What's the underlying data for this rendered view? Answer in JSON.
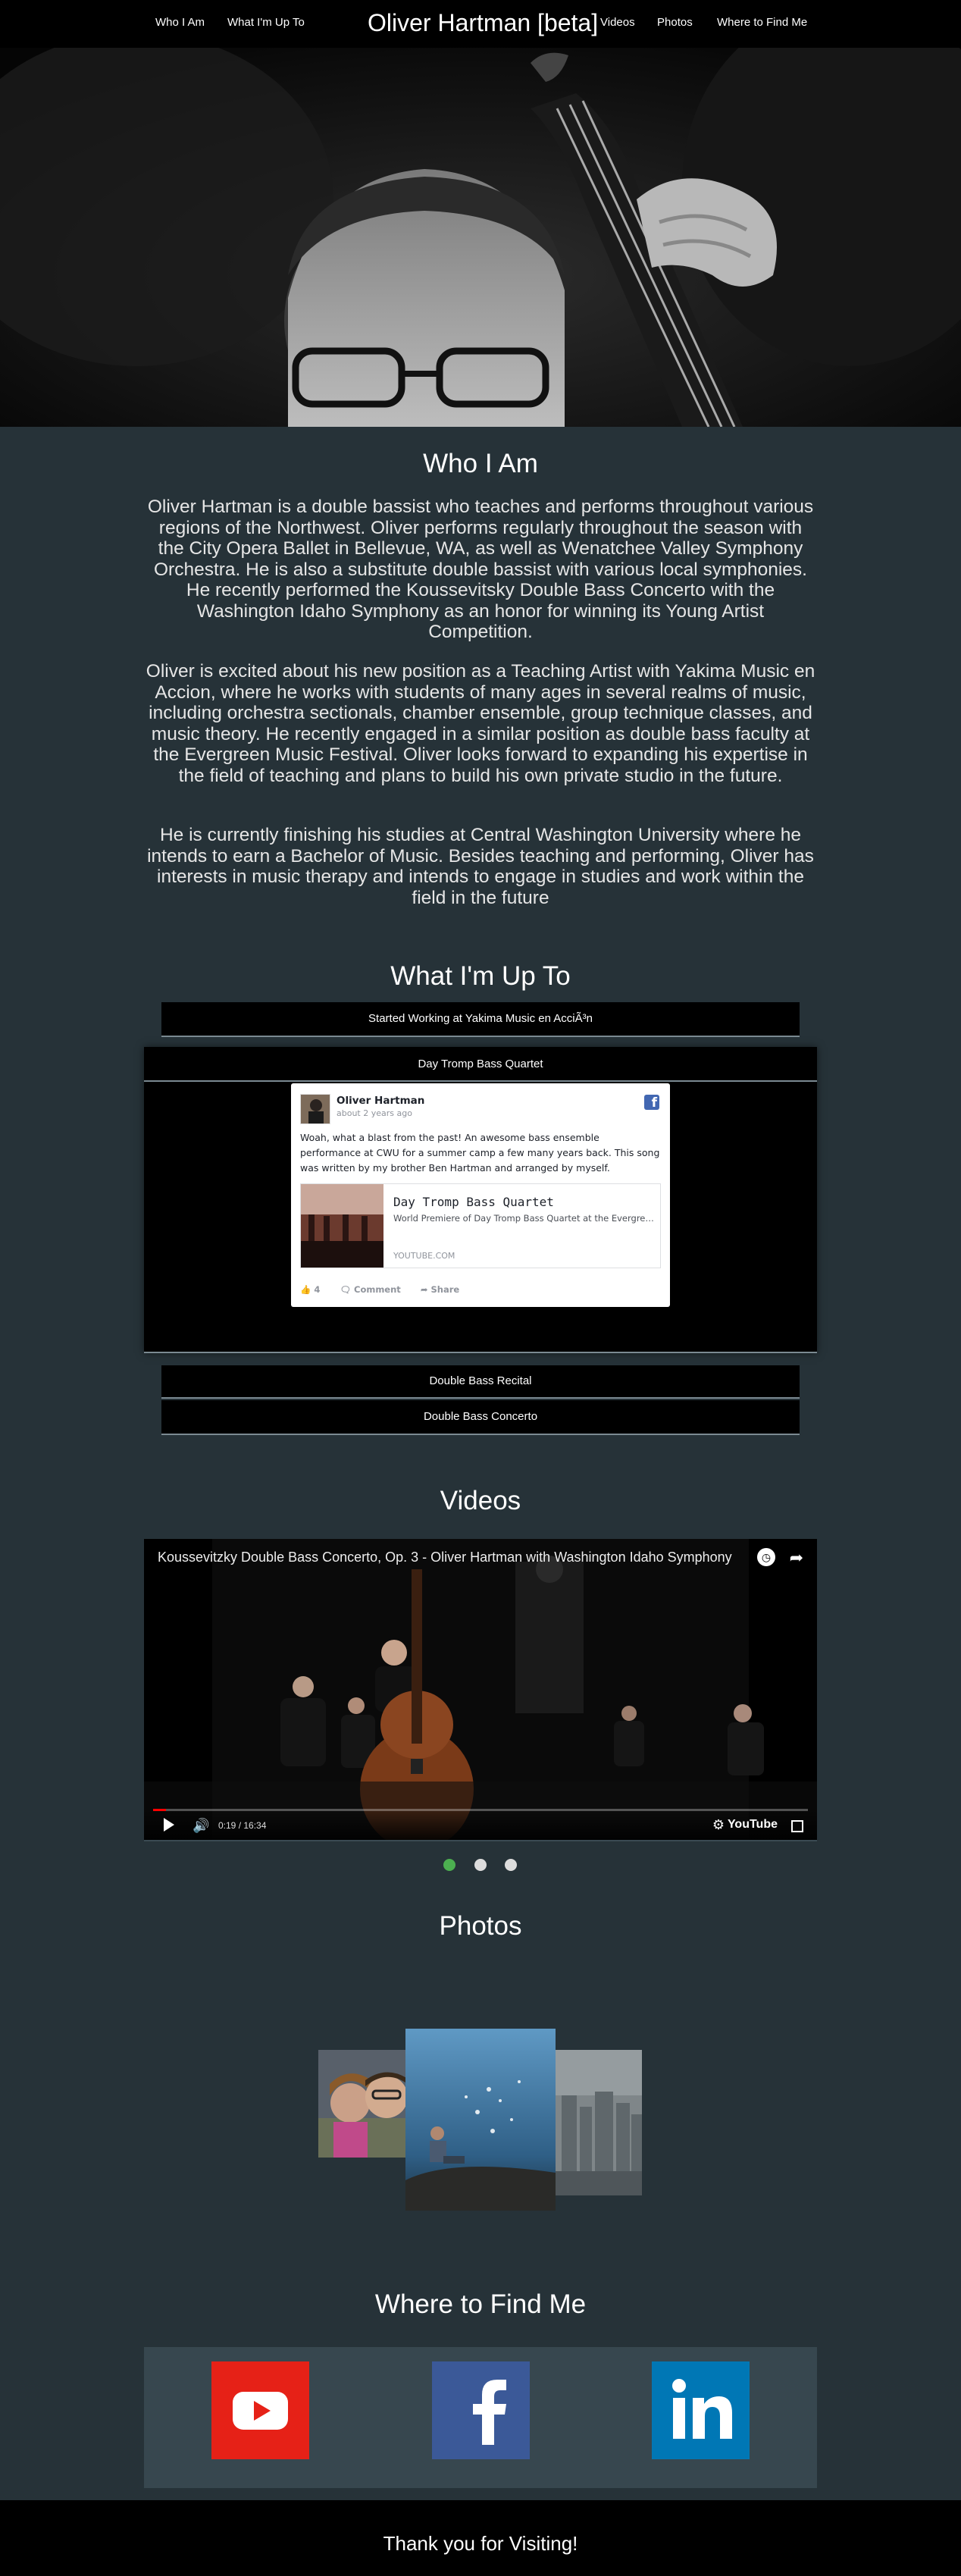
{
  "nav": {
    "brand": "Oliver Hartman [beta]",
    "links": [
      "Who I Am",
      "What I'm Up To",
      "Videos",
      "Photos",
      "Where to Find Me"
    ]
  },
  "about": {
    "title": "Who I Am",
    "paragraphs": [
      "Oliver Hartman is a double bassist who teaches and performs throughout various regions of the Northwest. Oliver performs regularly throughout the season with the City Opera Ballet in Bellevue, WA, as well as Wenatchee Valley Symphony Orchestra. He is also a substitute double bassist with various local symphonies. He recently performed the Koussevitsky Double Bass Concerto with the Washington Idaho Symphony as an honor for winning its Young Artist Competition.",
      "Oliver is excited about his new position as a Teaching Artist with Yakima Music en Accion, where he works with students of many ages in several realms of music, including orchestra sectionals, chamber ensemble, group technique classes, and music theory. He recently engaged in a similar position as double bass faculty at the Evergreen Music Festival. Oliver looks forward to expanding his expertise in the field of teaching and plans to build his own private studio in the future.",
      "He is currently finishing his studies at Central Washington University where he intends to earn a Bachelor of Music. Besides teaching and performing, Oliver has interests in music therapy and intends to engage in studies and work within the field in the future"
    ]
  },
  "upto": {
    "title": "What I'm Up To",
    "items": [
      "Started Working at Yakima Music en AcciÃ³n",
      "Day Tromp Bass Quartet",
      "Double Bass Recital",
      "Double Bass Concerto"
    ],
    "post": {
      "author": "Oliver Hartman",
      "time": "about 2 years ago",
      "logo": "f",
      "text": "Woah, what a blast from the past! An awesome bass ensemble performance at CWU for a summer camp a few many years back. This song was written by my brother Ben Hartman and arranged by myself.",
      "link_title": "Day Tromp Bass Quartet",
      "link_desc": "World Premiere of Day Tromp Bass Quartet at the Evergreen Music Festival",
      "link_domain": "YOUTUBE.COM",
      "likes": "4",
      "comment": "Comment",
      "share": "Share"
    }
  },
  "videos": {
    "title": "Videos",
    "video_title": "Koussevitzky Double Bass Concerto, Op. 3 - Oliver Hartman with Washington Idaho Symphony",
    "time": "0:19 / 16:34",
    "progress": 0.02,
    "brand": "YouTube",
    "active_dot": 0,
    "dot_count": 3
  },
  "photos": {
    "title": "Photos"
  },
  "find": {
    "title": "Where to Find Me",
    "links": [
      {
        "name": "YouTube",
        "color": "#e62117"
      },
      {
        "name": "Facebook",
        "color": "#3b5998"
      },
      {
        "name": "LinkedIn",
        "color": "#0077b5"
      }
    ]
  },
  "footer": {
    "text": "Thank you for Visiting!"
  },
  "colors": {
    "page_bg": "#263238",
    "panel_bg": "#37474f",
    "dot_active": "#4caf50"
  }
}
